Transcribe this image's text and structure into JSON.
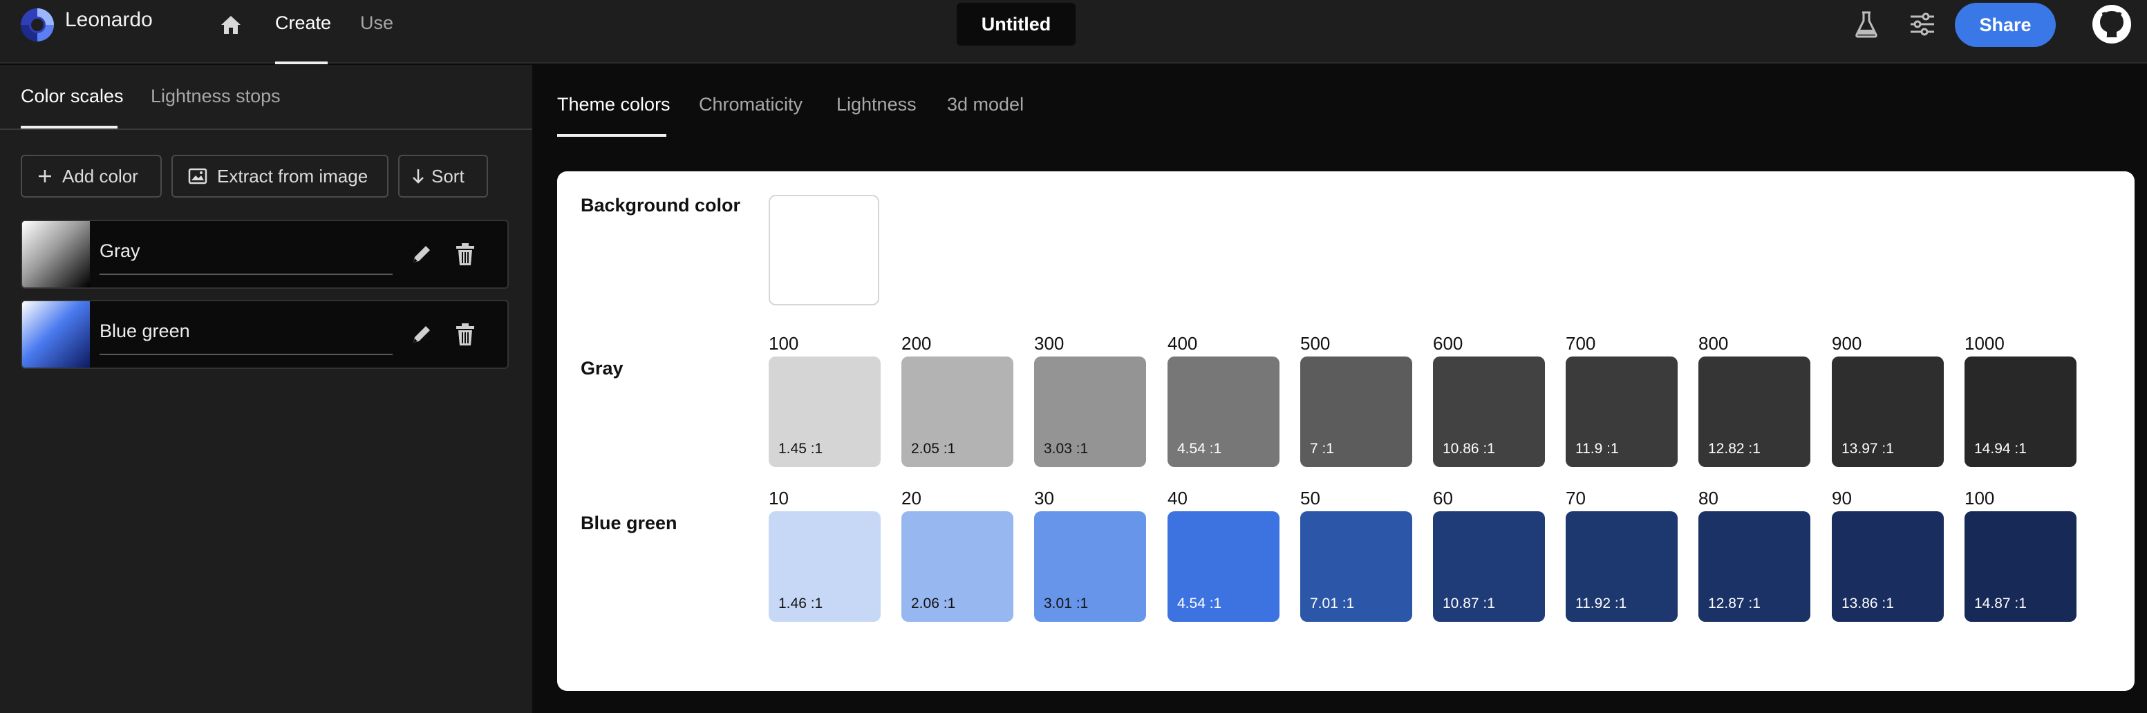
{
  "app": {
    "name": "Leonardo",
    "document_title": "Untitled"
  },
  "nav": {
    "create": "Create",
    "use": "Use"
  },
  "header": {
    "share_label": "Share"
  },
  "left_panel": {
    "tabs": [
      "Color scales",
      "Lightness stops"
    ],
    "actions": {
      "add": "Add color",
      "extract": "Extract from image",
      "sort": "Sort"
    },
    "scales": [
      {
        "name": "Gray"
      },
      {
        "name": "Blue green"
      }
    ]
  },
  "main": {
    "tabs": [
      "Theme colors",
      "Chromaticity",
      "Lightness",
      "3d model"
    ],
    "background": {
      "label": "Background color",
      "color": "#ffffff"
    },
    "rows": [
      {
        "label": "Gray",
        "steps": [
          {
            "label": "100",
            "color": "#d5d5d5",
            "ratio": "1.45 :1",
            "text": "#111111"
          },
          {
            "label": "200",
            "color": "#b3b3b3",
            "ratio": "2.05 :1",
            "text": "#111111"
          },
          {
            "label": "300",
            "color": "#949494",
            "ratio": "3.03 :1",
            "text": "#111111"
          },
          {
            "label": "400",
            "color": "#777777",
            "ratio": "4.54 :1",
            "text": "#ffffff"
          },
          {
            "label": "500",
            "color": "#5c5c5c",
            "ratio": "7 :1",
            "text": "#ffffff"
          },
          {
            "label": "600",
            "color": "#424242",
            "ratio": "10.86 :1",
            "text": "#ffffff"
          },
          {
            "label": "700",
            "color": "#3b3b3b",
            "ratio": "11.9 :1",
            "text": "#ffffff"
          },
          {
            "label": "800",
            "color": "#353535",
            "ratio": "12.82 :1",
            "text": "#ffffff"
          },
          {
            "label": "900",
            "color": "#2e2e2e",
            "ratio": "13.97 :1",
            "text": "#ffffff"
          },
          {
            "label": "1000",
            "color": "#282828",
            "ratio": "14.94 :1",
            "text": "#ffffff"
          }
        ]
      },
      {
        "label": "Blue green",
        "steps": [
          {
            "label": "10",
            "color": "#c6d8f6",
            "ratio": "1.46 :1",
            "text": "#111111"
          },
          {
            "label": "20",
            "color": "#97b7f0",
            "ratio": "2.06 :1",
            "text": "#111111"
          },
          {
            "label": "30",
            "color": "#6795ea",
            "ratio": "3.01 :1",
            "text": "#111111"
          },
          {
            "label": "40",
            "color": "#3d72e1",
            "ratio": "4.54 :1",
            "text": "#ffffff"
          },
          {
            "label": "50",
            "color": "#2c57a9",
            "ratio": "7.01 :1",
            "text": "#ffffff"
          },
          {
            "label": "60",
            "color": "#203c78",
            "ratio": "10.87 :1",
            "text": "#ffffff"
          },
          {
            "label": "70",
            "color": "#1d376f",
            "ratio": "11.92 :1",
            "text": "#ffffff"
          },
          {
            "label": "80",
            "color": "#1b3267",
            "ratio": "12.87 :1",
            "text": "#ffffff"
          },
          {
            "label": "90",
            "color": "#192e5f",
            "ratio": "13.86 :1",
            "text": "#ffffff"
          },
          {
            "label": "100",
            "color": "#172a57",
            "ratio": "14.87 :1",
            "text": "#ffffff"
          }
        ]
      }
    ]
  },
  "icons": {
    "logo": "leonardo-logo-icon",
    "home": "home-icon",
    "beaker": "beaker-icon",
    "settings": "sliders-icon",
    "github": "github-icon",
    "add": "plus-icon",
    "extract": "image-icon",
    "sort": "arrow-down-icon",
    "edit": "pencil-icon",
    "delete": "trash-icon"
  },
  "colors": {
    "accent": "#3b78e7"
  }
}
